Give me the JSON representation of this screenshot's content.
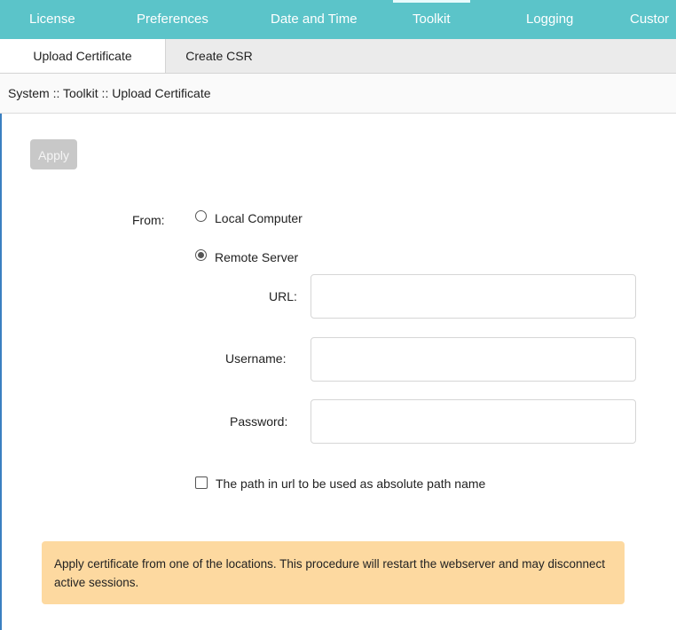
{
  "topnav": {
    "items": [
      "License",
      "Preferences",
      "Date and Time",
      "Toolkit",
      "Logging",
      "Custor"
    ],
    "active": "Toolkit"
  },
  "subtabs": [
    "Upload Certificate",
    "Create CSR"
  ],
  "breadcrumb": "System :: Toolkit :: Upload Certificate",
  "apply_label": "Apply",
  "form": {
    "from_label": "From:",
    "option_local": "Local Computer",
    "option_remote": "Remote Server",
    "selected": "Remote Server",
    "url_label": "URL:",
    "username_label": "Username:",
    "password_label": "Password:",
    "url_value": "",
    "username_value": "",
    "password_value": "",
    "absolute_path_label": "The path in url to be used as absolute path name",
    "absolute_path_checked": false
  },
  "notice": "Apply certificate from one of the locations. This procedure will restart the webserver and may disconnect active sessions.",
  "colors": {
    "nav_bg": "#5bc4c9",
    "notice_bg": "#fdd9a0",
    "apply_disabled": "#c8c8c8"
  }
}
